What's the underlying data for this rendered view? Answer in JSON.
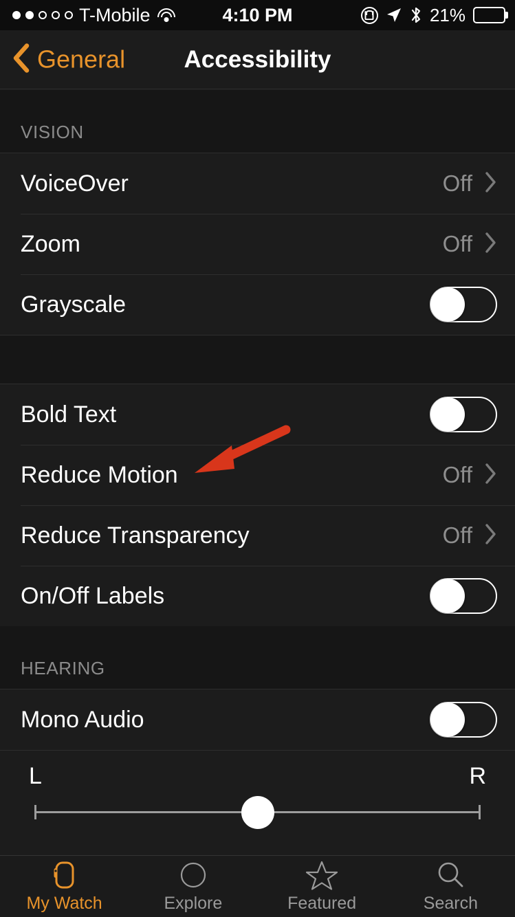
{
  "status_bar": {
    "signal_filled": 2,
    "signal_total": 5,
    "carrier": "T-Mobile",
    "wifi_icon": "wifi-icon",
    "time": "4:10 PM",
    "rotation_lock_icon": "rotation-lock-icon",
    "location_icon": "location-arrow-icon",
    "bluetooth_icon": "bluetooth-icon",
    "battery_percent": "21%",
    "battery_level": 21
  },
  "nav": {
    "back_label": "General",
    "back_icon": "chevron-left-icon",
    "title": "Accessibility",
    "accent_color": "#e8932b"
  },
  "sections": [
    {
      "header": "VISION",
      "rows": [
        {
          "label": "VoiceOver",
          "type": "disclosure",
          "value": "Off"
        },
        {
          "label": "Zoom",
          "type": "disclosure",
          "value": "Off"
        },
        {
          "label": "Grayscale",
          "type": "toggle",
          "value": "off"
        }
      ]
    },
    {
      "header": "",
      "rows": [
        {
          "label": "Bold Text",
          "type": "toggle",
          "value": "off"
        },
        {
          "label": "Reduce Motion",
          "type": "disclosure",
          "value": "Off"
        },
        {
          "label": "Reduce Transparency",
          "type": "disclosure",
          "value": "Off"
        },
        {
          "label": "On/Off Labels",
          "type": "toggle",
          "value": "off"
        }
      ]
    },
    {
      "header": "HEARING",
      "rows": [
        {
          "label": "Mono Audio",
          "type": "toggle",
          "value": "off"
        }
      ]
    }
  ],
  "balance_slider": {
    "left_label": "L",
    "right_label": "R",
    "position_percent": 50
  },
  "tabs": [
    {
      "label": "My Watch",
      "icon": "apple-watch-icon",
      "active": true
    },
    {
      "label": "Explore",
      "icon": "compass-icon",
      "active": false
    },
    {
      "label": "Featured",
      "icon": "star-icon",
      "active": false
    },
    {
      "label": "Search",
      "icon": "magnifier-icon",
      "active": false
    }
  ],
  "annotation": {
    "arrow_color": "#d8361b",
    "points_at": "Reduce Motion"
  },
  "colors": {
    "background": "#1c1c1c",
    "section_background": "#161616",
    "separator": "#2e2e2e",
    "primary_text": "#ffffff",
    "secondary_text": "#8e8e8e",
    "accent": "#e8932b"
  }
}
